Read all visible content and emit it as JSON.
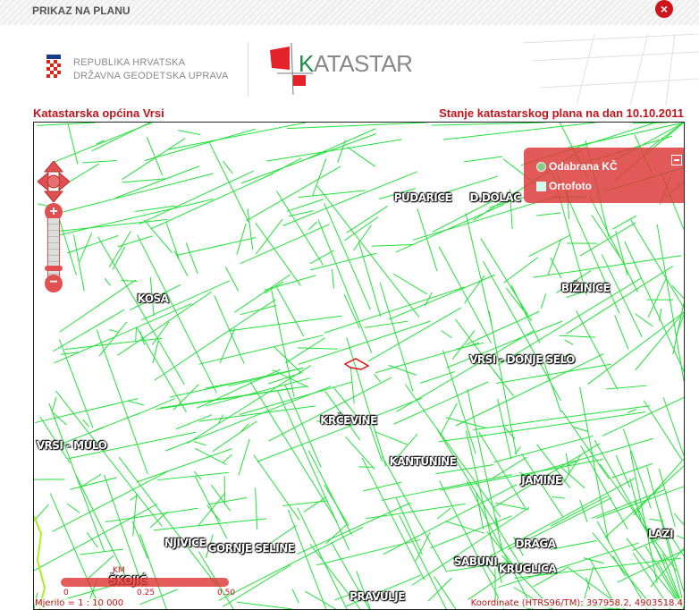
{
  "window": {
    "title": "PRIKAZ NA PLANU",
    "close": "×"
  },
  "header": {
    "org_line1": "REPUBLIKA HRVATSKA",
    "org_line2": "DRŽAVNA GEODETSKA UPRAVA",
    "logo_k": "K",
    "logo_rest": "ATASTAR"
  },
  "info": {
    "municipality": "Katastarska općina Vrsi",
    "plan_state": "Stanje katastarskog plana na dan 10.10.2011"
  },
  "layers": {
    "items": [
      {
        "label": "Odabrana KČ"
      },
      {
        "label": "Ortofoto"
      }
    ]
  },
  "places": [
    "PUDARICE",
    "D.DOLAC",
    "BIŽINICE",
    "KOSA",
    "VRSI - DONJE SELO",
    "KRČEVINE",
    "VRSI - MULO",
    "KANTUNINE",
    "JAMINE",
    "LAZI",
    "NJIVICE",
    "GORNJE SELINE",
    "DRAGA",
    "SABUNI",
    "KRUGLICA",
    "ŠKOJIĆ",
    "PRAVULJE"
  ],
  "scale": {
    "unit": "KM",
    "t0": "0",
    "t1": "0.25",
    "t2": "0.50",
    "ratio": "Mjerilo = 1 : 10 000"
  },
  "coords": "Koordinate (HTRS96/TM):  397958.2, 4903518.4",
  "colors": {
    "accent": "#c0141c",
    "parcel": "#22e03a",
    "panel": "#dc3c3c"
  }
}
